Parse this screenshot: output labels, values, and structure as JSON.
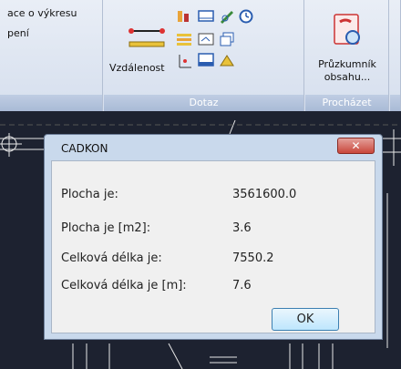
{
  "ribbon": {
    "group1": {
      "line1": "ace o výkresu",
      "line2": "pení"
    },
    "group2": {
      "button_label": "Vzdálenost",
      "footer": "Dotaz"
    },
    "group3": {
      "button_label_1": "Průzkumník",
      "button_label_2": "obsahu...",
      "footer": "Procházet"
    }
  },
  "dialog": {
    "title": "CADKON",
    "close_glyph": "✕",
    "rows": [
      {
        "label": "Plocha je:",
        "value": "3561600.0"
      },
      {
        "label": "Plocha je [m2]:",
        "value": "3.6"
      },
      {
        "label": "Celková délka je:",
        "value": "7550.2"
      },
      {
        "label": "Celková délka je [m]:",
        "value": "7.6"
      }
    ],
    "ok_label": "OK"
  },
  "icons": {
    "distance": "distance-measure-icon",
    "explorer": "content-explorer-icon"
  }
}
